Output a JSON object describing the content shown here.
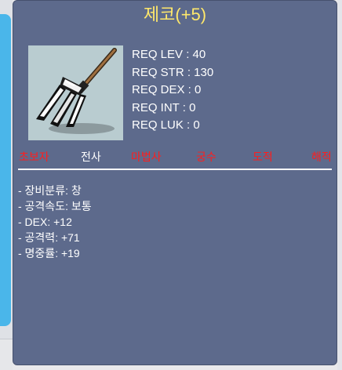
{
  "item": {
    "name": "제코(+5)",
    "icon": "pitchfork-weapon-icon"
  },
  "requirements": [
    {
      "label": "REQ LEV : 40"
    },
    {
      "label": "REQ STR : 130"
    },
    {
      "label": "REQ DEX : 0"
    },
    {
      "label": "REQ INT : 0"
    },
    {
      "label": "REQ LUK : 0"
    }
  ],
  "jobs": [
    {
      "label": "초보자",
      "allowed": false
    },
    {
      "label": "전사",
      "allowed": true
    },
    {
      "label": "마법사",
      "allowed": false
    },
    {
      "label": "궁수",
      "allowed": false
    },
    {
      "label": "도적",
      "allowed": false
    },
    {
      "label": "해적",
      "allowed": false
    }
  ],
  "stats": [
    {
      "label": "- 장비분류: 창"
    },
    {
      "label": "- 공격속도: 보통"
    },
    {
      "label": "- DEX: +12"
    },
    {
      "label": "- 공격력: +71"
    },
    {
      "label": "- 명중률: +19"
    }
  ],
  "colors": {
    "tooltip_bg": "#5d6a8c",
    "name": "#ffe86b",
    "job_disabled": "#ff1d1d",
    "job_enabled": "#ffffff"
  }
}
